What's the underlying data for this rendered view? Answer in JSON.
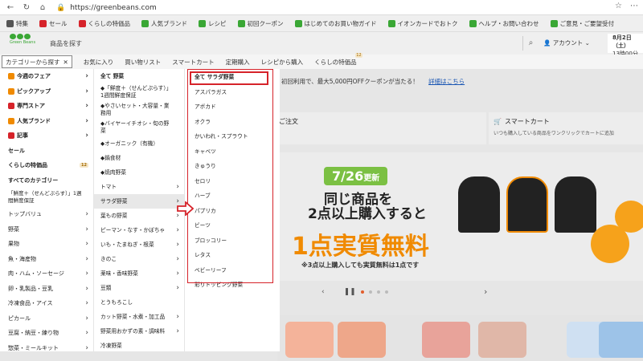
{
  "browser": {
    "url": "https://greenbeans.com"
  },
  "topnav": {
    "items": [
      {
        "label": "特集",
        "color": "#555555"
      },
      {
        "label": "セール",
        "color": "#d6232a"
      },
      {
        "label": "くらしの特価品",
        "color": "#d6232a"
      },
      {
        "label": "人気ブランド",
        "color": "#3aa735"
      },
      {
        "label": "レシピ",
        "color": "#3aa735"
      },
      {
        "label": "初回クーポン",
        "color": "#3aa735"
      },
      {
        "label": "はじめてのお買い物ガイド",
        "color": "#3aa735"
      },
      {
        "label": "イオンカードでおトク",
        "color": "#3aa735"
      },
      {
        "label": "ヘルプ・お問い合わせ",
        "color": "#3aa735"
      },
      {
        "label": "ご意見・ご要望受付",
        "color": "#3aa735"
      }
    ]
  },
  "header": {
    "logo_text": "Green Beans",
    "search_placeholder": "商品を探す",
    "account_label": "アカウント",
    "delivery_line1": "8月2日（土）",
    "delivery_line2": "13時00分～14時"
  },
  "catnav": {
    "category_button": "カテゴリーから探す",
    "items": [
      "お気に入り",
      "買い物リスト",
      "スマートカート",
      "定期購入",
      "レシピから購入",
      "くらしの特価品"
    ],
    "badge": "12"
  },
  "menu_col1": {
    "items": [
      {
        "label": "今週のフェア",
        "icon": "megaphone-icon",
        "icon_color": "#f08a00",
        "chev": true,
        "bold": true
      },
      {
        "label": "ピックアップ",
        "icon": "bulb-icon",
        "icon_color": "#f08a00",
        "chev": true,
        "bold": true
      },
      {
        "label": "専門ストア",
        "icon": "store-icon",
        "icon_color": "#d6232a",
        "chev": true,
        "bold": true
      },
      {
        "label": "人気ブランド",
        "icon": "star-icon",
        "icon_color": "#f08a00",
        "chev": true,
        "bold": true
      },
      {
        "label": "記事",
        "icon": "article-icon",
        "icon_color": "#d6232a",
        "chev": true,
        "bold": true
      },
      {
        "label": "セール",
        "bold": true
      },
      {
        "label": "くらしの特価品",
        "badge": "12",
        "bold": true
      },
      {
        "label": "すべてのカテゴリー",
        "bold": true
      },
      {
        "label": "「鮮度＋（せんどぷらす）」1週間鮮度保証",
        "two": true
      },
      {
        "label": "トップバリュ",
        "chev": true
      },
      {
        "label": "野菜",
        "chev": true
      },
      {
        "label": "果物",
        "chev": true
      },
      {
        "label": "魚・海産物",
        "chev": true
      },
      {
        "label": "肉・ハム・ソーセージ",
        "chev": true
      },
      {
        "label": "卵・乳製品・豆乳",
        "chev": true
      },
      {
        "label": "冷凍食品・アイス",
        "chev": true
      },
      {
        "label": "ピカール",
        "chev": true
      },
      {
        "label": "豆腐・納豆・練り物",
        "chev": true
      },
      {
        "label": "惣菜・ミールキット",
        "chev": true
      },
      {
        "label": "パン・シリアル・ジャム・は",
        "chev": true
      }
    ]
  },
  "menu_col2": {
    "items": [
      {
        "label": "全て 野菜",
        "head": true
      },
      {
        "label": "◆「鮮度＋（せんどぷらす）」1週間鮮度保証"
      },
      {
        "label": "◆やさいセット・大容量・業務用"
      },
      {
        "label": "◆バイヤーイチオシ・旬の野菜"
      },
      {
        "label": "◆オーガニック（有機）"
      },
      {
        "label": "◆鍋食材"
      },
      {
        "label": "◆焼肉野菜"
      },
      {
        "label": "トマト",
        "chev": true
      },
      {
        "label": "サラダ野菜",
        "chev": true,
        "sel": true
      },
      {
        "label": "葉もの野菜",
        "chev": true
      },
      {
        "label": "ピーマン・なす・かぼちゃ",
        "chev": true
      },
      {
        "label": "いも・たまねぎ・根菜",
        "chev": true
      },
      {
        "label": "きのこ",
        "chev": true
      },
      {
        "label": "薬味・香味野菜",
        "chev": true
      },
      {
        "label": "豆類",
        "chev": true
      },
      {
        "label": "とうもろこし"
      },
      {
        "label": "カット野菜・水煮・加工品",
        "chev": true
      },
      {
        "label": "野菜用おかずの素・調味料",
        "chev": true
      },
      {
        "label": "冷凍野菜"
      }
    ]
  },
  "menu_col3": {
    "items": [
      {
        "label": "全て サラダ野菜",
        "head": true
      },
      {
        "label": "アスパラガス"
      },
      {
        "label": "アボカド"
      },
      {
        "label": "オクラ"
      },
      {
        "label": "かいわれ・スプラウト"
      },
      {
        "label": "キャベツ"
      },
      {
        "label": "きゅうり"
      },
      {
        "label": "セロリ"
      },
      {
        "label": "ハーブ"
      },
      {
        "label": "パプリカ"
      },
      {
        "label": "ビーツ"
      },
      {
        "label": "ブロッコリー"
      },
      {
        "label": "レタス"
      },
      {
        "label": "ベビーリーフ"
      },
      {
        "label": "彩りトッピング野菜"
      }
    ]
  },
  "main": {
    "promo_text": "初回利用で、最大5,000円OFFクーポンが当たる！",
    "promo_link": "詳細はこちら",
    "card1_title": "ご注文",
    "card2_title": "スマートカート",
    "card2_sub": "いつも購入している商品をワンクリックでカートに追加",
    "banner_date": "7/26",
    "banner_date_suffix": "更新",
    "banner_line1": "同じ商品を",
    "banner_line2": "2点以上購入すると",
    "banner_big": "1点実質無料",
    "banner_note": "※3点以上購入しても実質無料は1点です"
  },
  "colors": {
    "brand_green": "#3aa735",
    "highlight_red": "#d6232a",
    "accent_orange": "#f08a00"
  }
}
